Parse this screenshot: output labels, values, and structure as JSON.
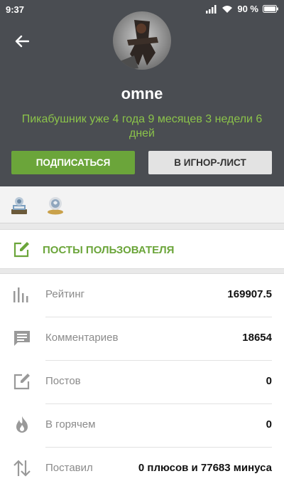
{
  "status_bar": {
    "time": "9:37",
    "battery": "90 %"
  },
  "profile": {
    "username": "omne",
    "since": "Пикабушник уже 4 года 9 месяцев 3 недели 6 дней"
  },
  "buttons": {
    "subscribe": "ПОДПИСАТЬСЯ",
    "ignore": "В ИГНОР-ЛИСТ"
  },
  "posts_link": {
    "label": "ПОСТЫ ПОЛЬЗОВАТЕЛЯ"
  },
  "stats": [
    {
      "label": "Рейтинг",
      "value": "169907.5",
      "icon": "rating-bars-icon"
    },
    {
      "label": "Комментариев",
      "value": "18654",
      "icon": "comment-icon"
    },
    {
      "label": "Постов",
      "value": "0",
      "icon": "edit-icon"
    },
    {
      "label": "В горячем",
      "value": "0",
      "icon": "flame-icon"
    },
    {
      "label": "Поставил",
      "value": "0 плюсов и 77683 минуса",
      "icon": "up-down-arrows-icon"
    }
  ],
  "colors": {
    "header_bg": "#4a4d52",
    "accent_green": "#6ba53a",
    "since_green": "#8bc34a"
  }
}
